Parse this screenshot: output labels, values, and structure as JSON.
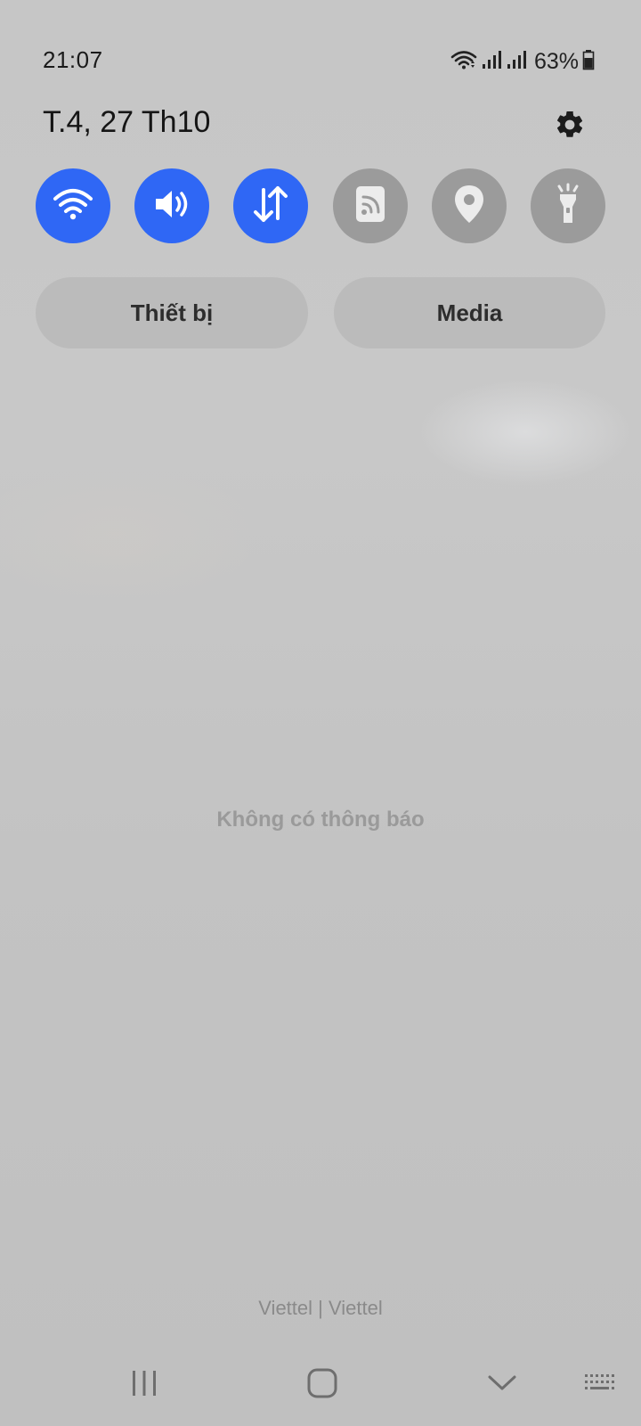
{
  "status_bar": {
    "time": "21:07",
    "battery_percent": "63%",
    "icons": [
      "wifi-icon",
      "signal-icon",
      "signal-icon",
      "battery-icon"
    ]
  },
  "header": {
    "date": "T.4, 27 Th10",
    "settings_icon": "gear-icon"
  },
  "quick_toggles": [
    {
      "icon": "wifi-icon",
      "state": "on"
    },
    {
      "icon": "sound-icon",
      "state": "on"
    },
    {
      "icon": "mobile-data-icon",
      "state": "on"
    },
    {
      "icon": "nfc-icon",
      "state": "off"
    },
    {
      "icon": "location-icon",
      "state": "off"
    },
    {
      "icon": "flashlight-icon",
      "state": "off"
    }
  ],
  "panel_buttons": {
    "devices_label": "Thiết bị",
    "media_label": "Media"
  },
  "notifications": {
    "empty_text": "Không có thông báo"
  },
  "carrier": "Viettel | Viettel",
  "nav_bar": [
    "recents-icon",
    "home-icon",
    "collapse-icon",
    "keyboard-icon"
  ],
  "colors": {
    "accent": "#2f67f5",
    "toggle_off": "#9b9b9b",
    "background": "#c6c6c6"
  }
}
